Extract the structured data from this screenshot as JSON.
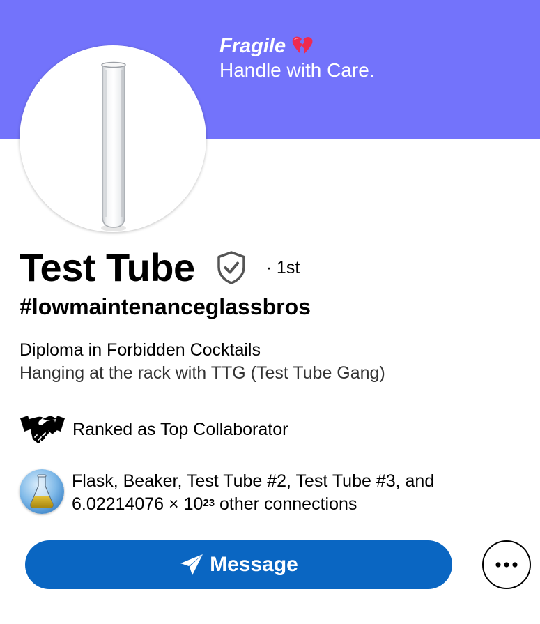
{
  "banner": {
    "title": "Fragile",
    "title_emoji": "broken-heart-icon",
    "subtitle": "Handle with Care.",
    "color": "#7373fb"
  },
  "profile": {
    "name": "Test Tube",
    "verified_icon": "shield-check-icon",
    "degree": "· 1st",
    "hashtag": "#lowmaintenanceglassbros",
    "headline": "Diploma in Forbidden Cocktails",
    "location": "Hanging at the rack with TTG (Test Tube Gang)"
  },
  "highlights": {
    "rank_icon": "handshake-icon",
    "rank_text": "Ranked as Top Collaborator"
  },
  "connections": {
    "avatar_icon": "flask-icon",
    "line1": "Flask, Beaker, Test Tube #2, Test Tube #3, and",
    "line2_prefix": "6.02214076 × 10",
    "line2_exponent": "23",
    "line2_suffix": " other connections"
  },
  "actions": {
    "message_label": "Message",
    "message_icon": "send-icon",
    "more_icon": "more-dots-icon",
    "primary_color": "#0a66c2"
  }
}
